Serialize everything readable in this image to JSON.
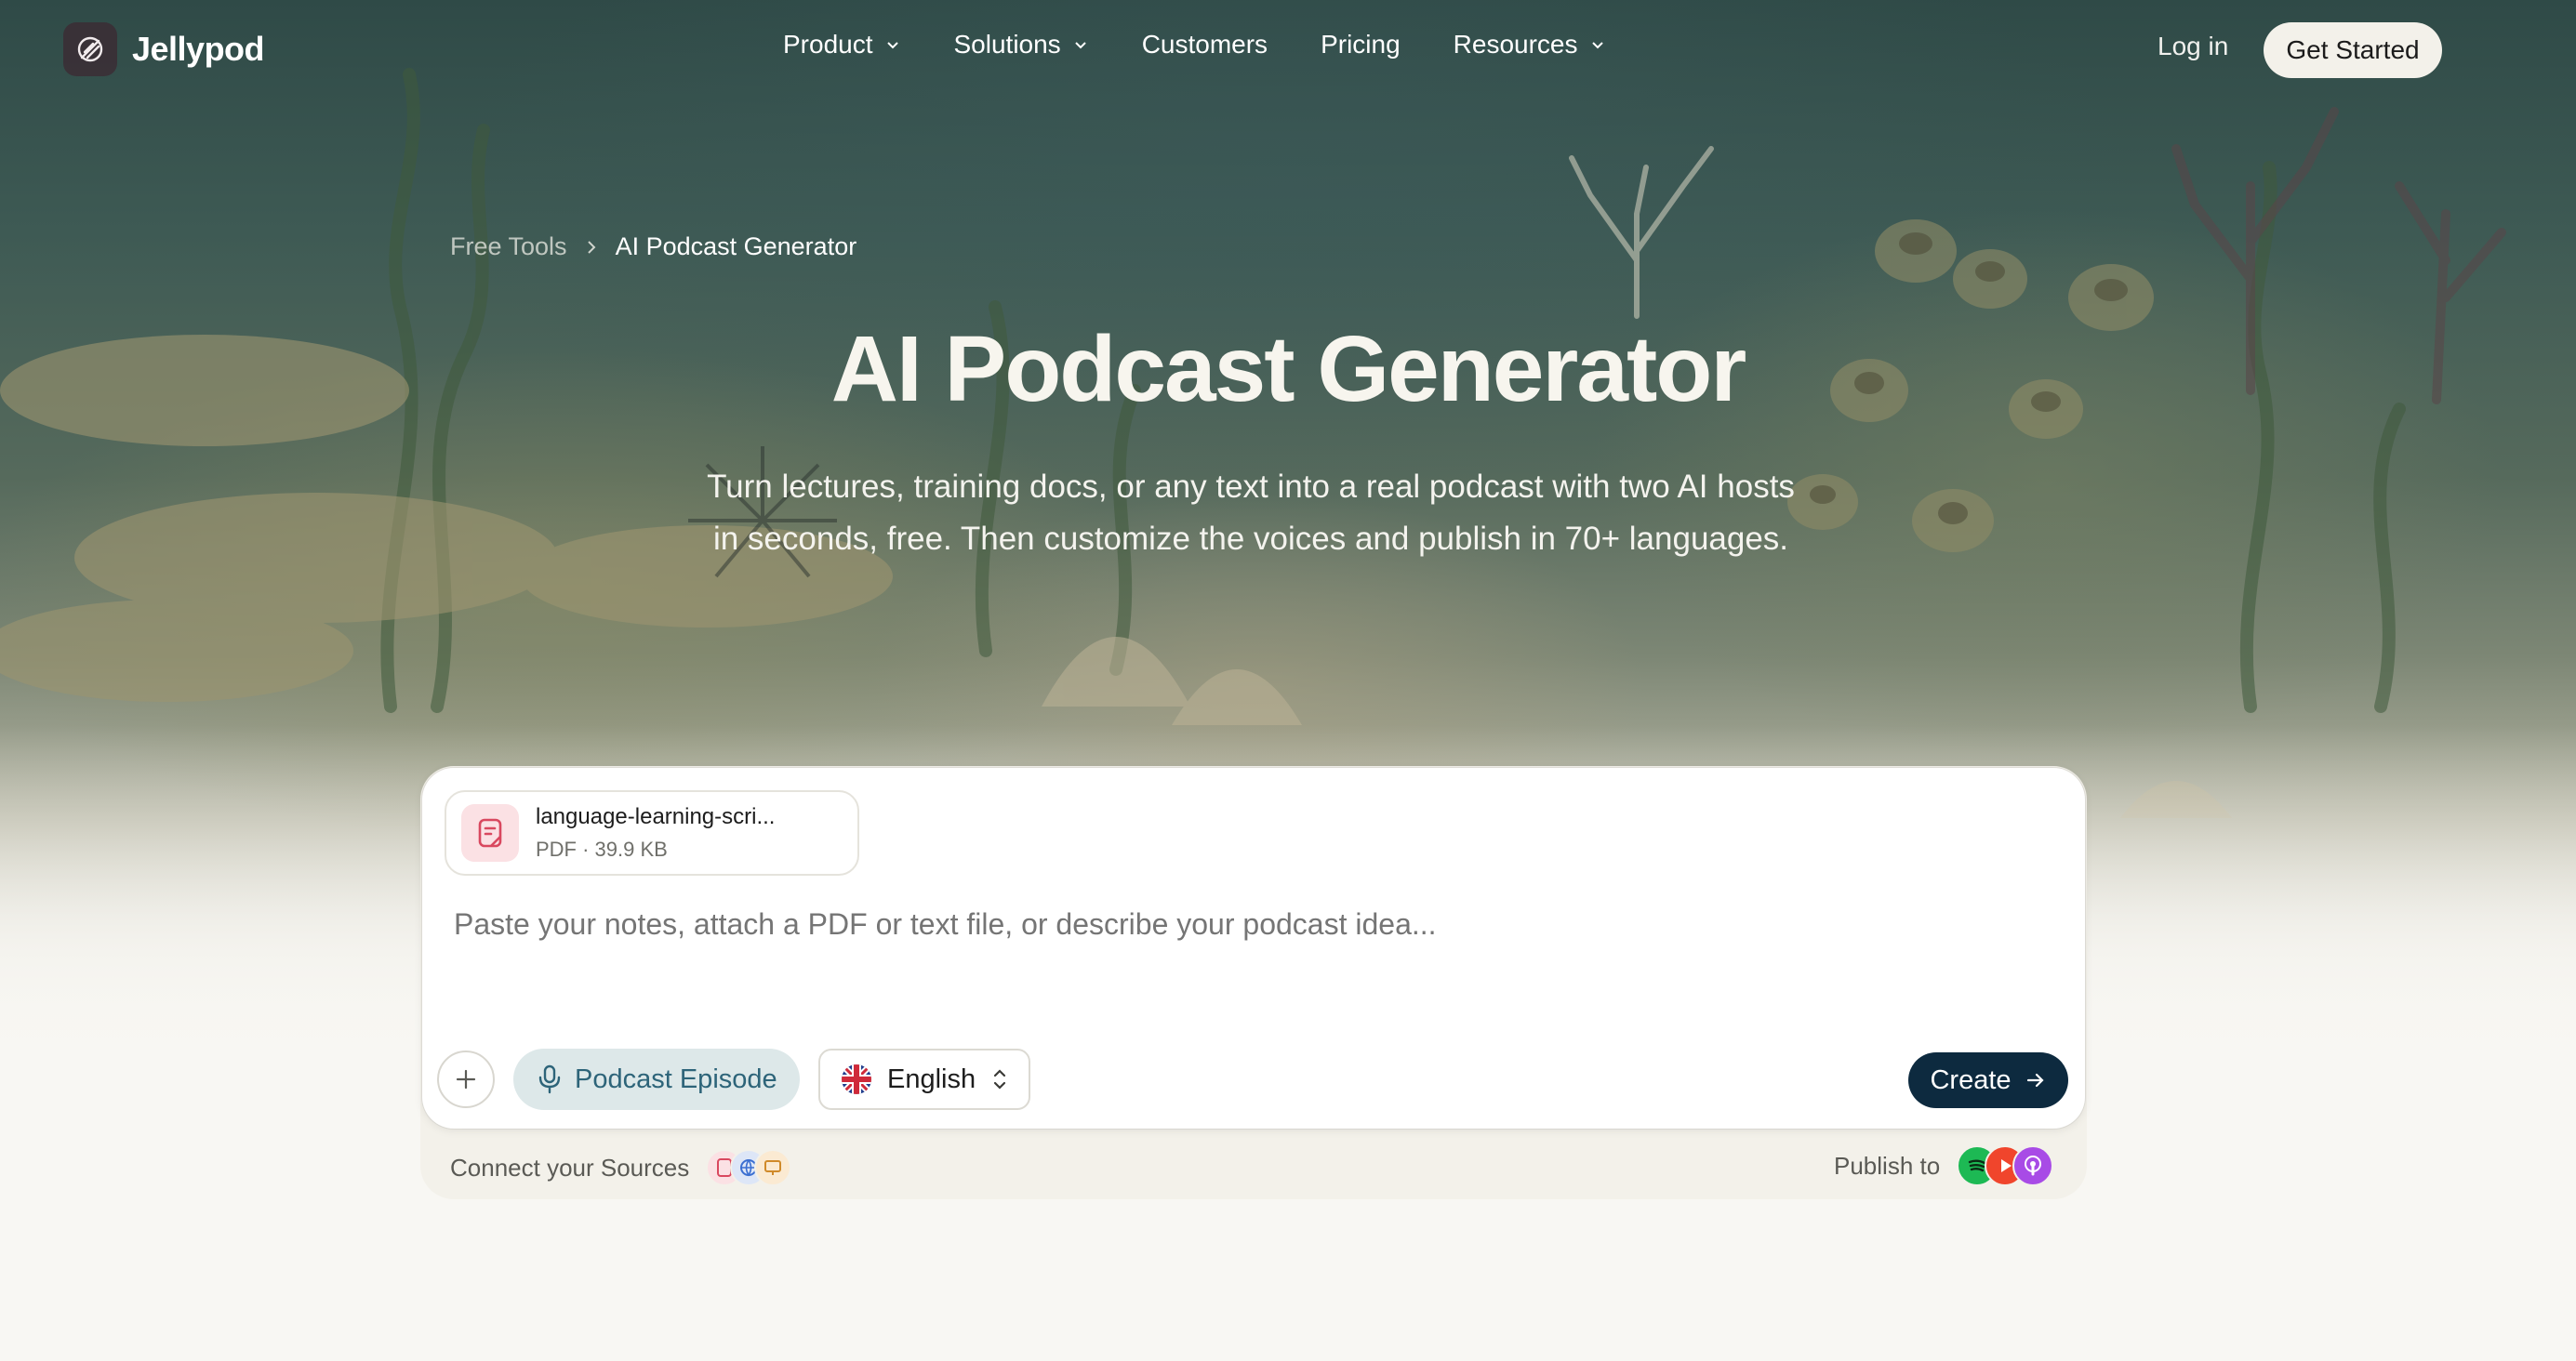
{
  "nav": {
    "brand": "Jellypod",
    "links": [
      {
        "label": "Product",
        "dropdown": true
      },
      {
        "label": "Solutions",
        "dropdown": true
      },
      {
        "label": "Customers",
        "dropdown": false
      },
      {
        "label": "Pricing",
        "dropdown": false
      },
      {
        "label": "Resources",
        "dropdown": true
      }
    ],
    "login": "Log in",
    "cta": "Get Started"
  },
  "breadcrumb": {
    "parent": "Free Tools",
    "separator": ">",
    "current": "AI Podcast Generator"
  },
  "hero": {
    "title": "AI Podcast Generator",
    "subtitle": "Turn lectures, training docs, or any text into a real podcast with two AI hosts in seconds, free. Then customize the voices and publish in 70+ languages."
  },
  "composer": {
    "attachment": {
      "name": "language-learning-scri...",
      "meta": "PDF · 39.9 KB",
      "icon": "document-icon"
    },
    "prompt_placeholder": "Paste your notes, attach a PDF or text file, or describe your podcast idea...",
    "format_label": "Podcast Episode",
    "language_label": "English",
    "create_label": "Create"
  },
  "footer": {
    "sources_label": "Connect your Sources",
    "source_icons": [
      "pdf-icon",
      "web-icon",
      "slides-icon"
    ],
    "publish_label": "Publish to",
    "publish_icons": [
      "spotify-icon",
      "youtube-icon",
      "apple-podcasts-icon"
    ]
  },
  "colors": {
    "accent": "#0d2a3f",
    "format_bg": "#dde8e9",
    "format_text": "#2d6479",
    "page_bg": "#f8f7f3"
  }
}
